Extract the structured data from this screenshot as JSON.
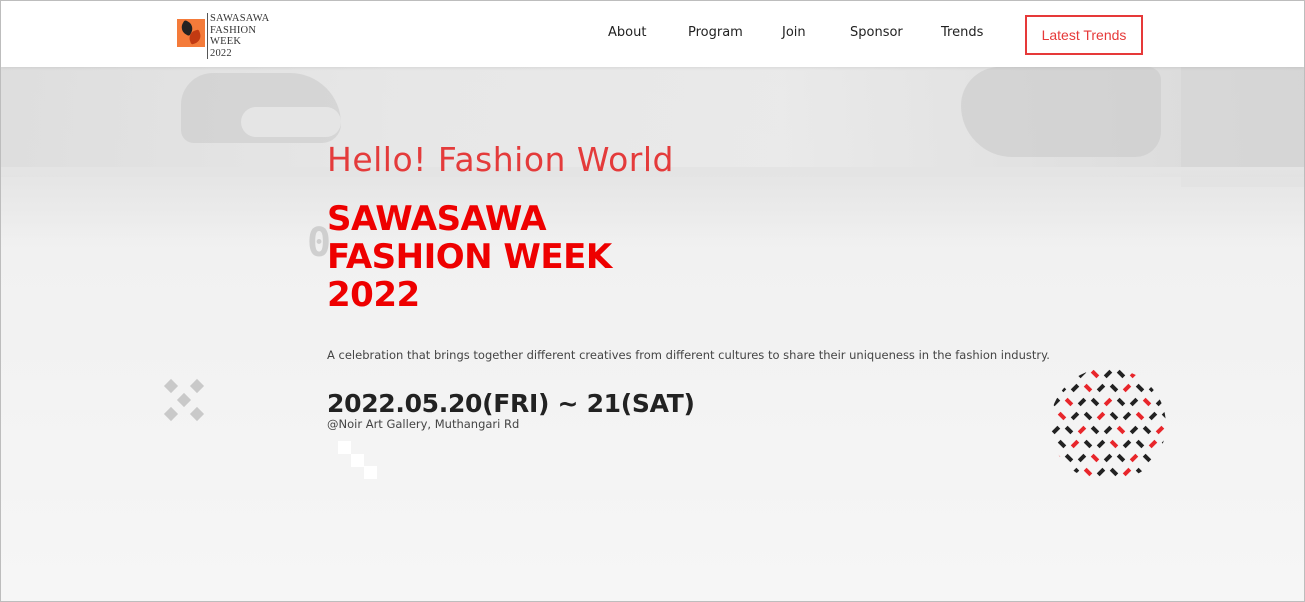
{
  "header": {
    "logo": {
      "lines": [
        "SAWASAWA",
        "FASHION",
        "WEEK",
        "2022"
      ]
    },
    "nav": {
      "about": "About",
      "program": "Program",
      "join": "Join",
      "sponsor": "Sponsor",
      "trends": "Trends"
    },
    "cta_label": "Latest Trends"
  },
  "hero": {
    "greeting": "Hello! Fashion World",
    "title_lines": [
      "SAWASAWA",
      "FASHION WEEK",
      "2022"
    ],
    "description": "A celebration that brings together different creatives from different cultures to share their uniqueness in the fashion industry.",
    "date": "2022.05.20(FRI) ~ 21(SAT)",
    "venue": "@Noir Art Gallery, Muthangari Rd",
    "ghost_glyph": "0"
  },
  "colors": {
    "accent": "#ee0000",
    "greeting": "#e43b3b",
    "cta_border": "#e63939",
    "pattern_red": "#e8262b",
    "pattern_dark": "#222222"
  },
  "icons": {
    "logo": "butterfly-logo-icon",
    "x_decoration": "x-cross-icon",
    "pattern": "dotted-circle-pattern-icon"
  }
}
